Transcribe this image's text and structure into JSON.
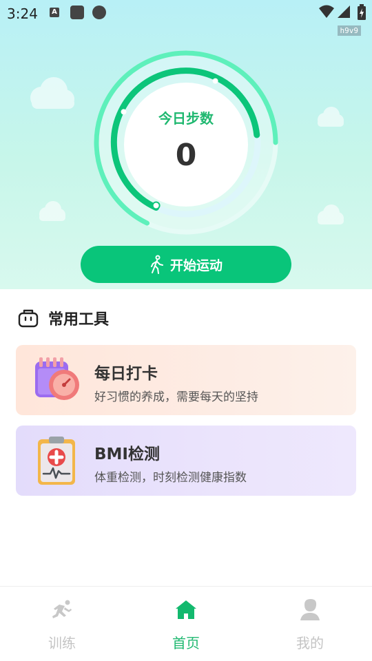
{
  "status_bar": {
    "time": "3:24",
    "tag": "h9v9",
    "notif_letter": "A"
  },
  "hero": {
    "ring_title": "今日步数",
    "steps": "0",
    "start_button": "开始运动"
  },
  "tools": {
    "header": "常用工具",
    "cards": [
      {
        "title": "每日打卡",
        "subtitle": "好习惯的养成，需要每天的坚持"
      },
      {
        "title": "BMI检测",
        "subtitle": "体重检测，时刻检测健康指数"
      }
    ]
  },
  "bottom_nav": {
    "items": [
      {
        "label": "训练",
        "icon": "run-icon",
        "active": false
      },
      {
        "label": "首页",
        "icon": "home-icon",
        "active": true
      },
      {
        "label": "我的",
        "icon": "person-icon",
        "active": false
      }
    ]
  },
  "colors": {
    "accent": "#09c57a",
    "accent_text": "#1fb870",
    "inactive": "#c4c4c4"
  }
}
